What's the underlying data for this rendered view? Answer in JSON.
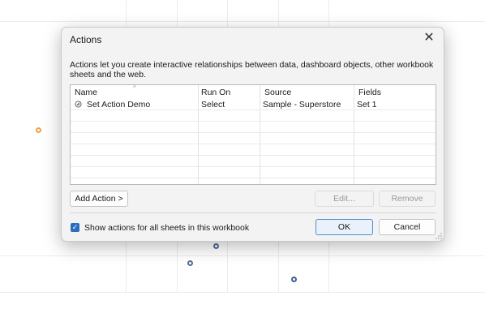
{
  "dialog": {
    "title": "Actions",
    "close_icon": "close-icon",
    "description": "Actions let you create interactive relationships between data, dashboard objects, other workbook sheets and the web.",
    "columns": [
      "Name",
      "Run On",
      "Source",
      "Fields"
    ],
    "rows": [
      {
        "icon": "set-action-icon",
        "name": "Set Action Demo",
        "run_on": "Select",
        "source": "Sample - Superstore",
        "fields": "Set 1"
      }
    ],
    "buttons": {
      "add_action": "Add Action >",
      "edit": "Edit...",
      "remove": "Remove",
      "ok": "OK",
      "cancel": "Cancel"
    },
    "show_all_checkbox": {
      "label": "Show actions for all sheets in this workbook",
      "checked": true
    }
  },
  "colors": {
    "accent": "#2a6ebd",
    "dot_orange": "#f0a040",
    "dot_blue": "#4f6f9a"
  }
}
